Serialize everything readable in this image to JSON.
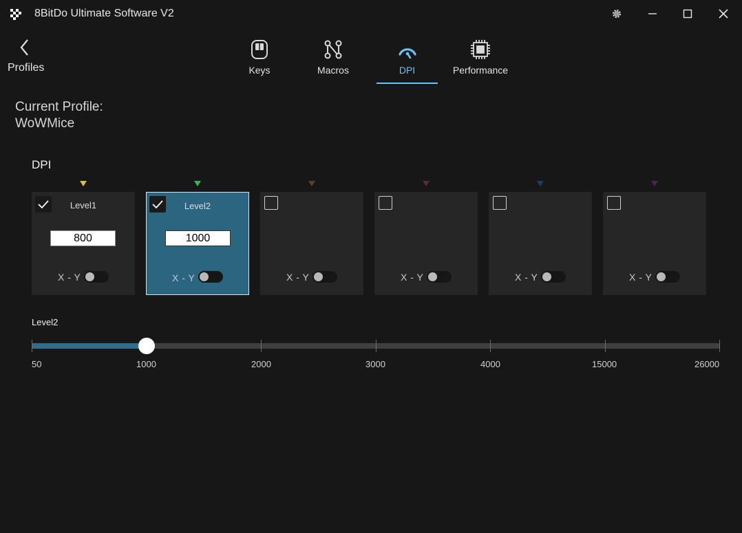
{
  "window": {
    "title": "8BitDo Ultimate Software V2",
    "controls": [
      "settings-icon",
      "minimize-icon",
      "maximize-icon",
      "close-icon"
    ]
  },
  "nav": {
    "back_label": "Profiles",
    "tabs": [
      {
        "label": "Keys",
        "icon": "mouse-icon",
        "active": false
      },
      {
        "label": "Macros",
        "icon": "macro-nodes-icon",
        "active": false
      },
      {
        "label": "DPI",
        "icon": "dpi-gauge-icon",
        "active": true
      },
      {
        "label": "Performance",
        "icon": "chip-icon",
        "active": false
      }
    ]
  },
  "profile": {
    "caption": "Current Profile:",
    "name": "WoWMice"
  },
  "dpi": {
    "section_title": "DPI",
    "levels": [
      {
        "marker_color": "#d9c23c",
        "enabled": true,
        "name": "Level1",
        "value": "800",
        "xy_label": "X - Y",
        "xy_enabled": false,
        "selected": false
      },
      {
        "marker_color": "#36b45a",
        "enabled": true,
        "name": "Level2",
        "value": "1000",
        "xy_label": "X - Y",
        "xy_enabled": false,
        "selected": true
      },
      {
        "marker_color": "#5a3f2c",
        "enabled": false,
        "name": "",
        "value": "",
        "xy_label": "X - Y",
        "xy_enabled": false,
        "selected": false
      },
      {
        "marker_color": "#5a2a38",
        "enabled": false,
        "name": "",
        "value": "",
        "xy_label": "X - Y",
        "xy_enabled": false,
        "selected": false
      },
      {
        "marker_color": "#1f3c66",
        "enabled": false,
        "name": "",
        "value": "",
        "xy_label": "X - Y",
        "xy_enabled": false,
        "selected": false
      },
      {
        "marker_color": "#4a2550",
        "enabled": false,
        "name": "",
        "value": "",
        "xy_label": "X - Y",
        "xy_enabled": false,
        "selected": false
      }
    ]
  },
  "slider": {
    "label": "Level2",
    "ticks": [
      "50",
      "1000",
      "2000",
      "3000",
      "4000",
      "15000",
      "26000"
    ],
    "value": "1000",
    "accent_color": "#2f6f8d"
  }
}
